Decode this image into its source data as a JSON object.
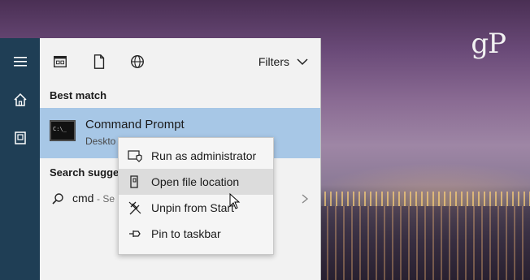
{
  "desktop": {
    "brand_text": "gP"
  },
  "nav_rail": {
    "icons": [
      "menu-icon",
      "home-icon",
      "documents-icon"
    ]
  },
  "toolbar": {
    "icons": [
      "apps-icon",
      "documents-icon",
      "web-icon"
    ],
    "filters_label": "Filters"
  },
  "best_match": {
    "title": "Best match",
    "app_name": "Command Prompt",
    "app_sub": "Deskto"
  },
  "suggestions": {
    "title": "Search sugges",
    "item": {
      "text": "cmd",
      "see_more": "- Se"
    }
  },
  "context_menu": {
    "items": [
      {
        "label": "Run as administrator",
        "icon": "shield-admin-icon"
      },
      {
        "label": "Open file location",
        "icon": "file-location-icon"
      },
      {
        "label": "Unpin from Start",
        "icon": "unpin-icon"
      },
      {
        "label": "Pin to taskbar",
        "icon": "pin-icon"
      }
    ],
    "hovered_index": 1
  },
  "colors": {
    "rail": "#1f3e55",
    "panel": "#f2f2f2",
    "selection": "#a7c7e6",
    "menu_hover": "#dcdcdc"
  }
}
